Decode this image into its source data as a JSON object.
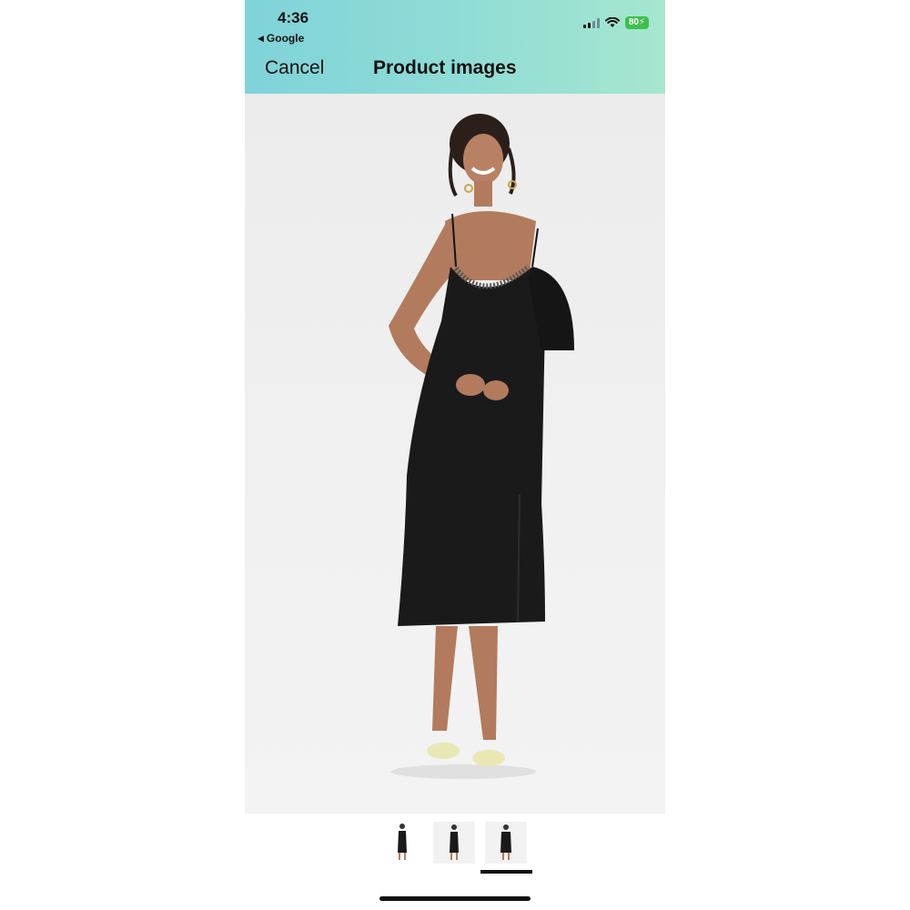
{
  "status_bar": {
    "time": "4:36",
    "back_app": "Google",
    "battery": "80"
  },
  "nav": {
    "cancel_label": "Cancel",
    "title": "Product images"
  },
  "gallery": {
    "image_count": 3,
    "selected_index": 3
  },
  "colors": {
    "header_gradient_start": "#7fd3d9",
    "header_gradient_end": "#a6e6cf",
    "battery_green": "#3fbf4e",
    "dress": "#1a1a1a",
    "sandals": "#e9e8b5"
  },
  "icons": [
    "back-triangle-icon",
    "cellular-signal-icon",
    "wifi-icon",
    "battery-icon"
  ]
}
